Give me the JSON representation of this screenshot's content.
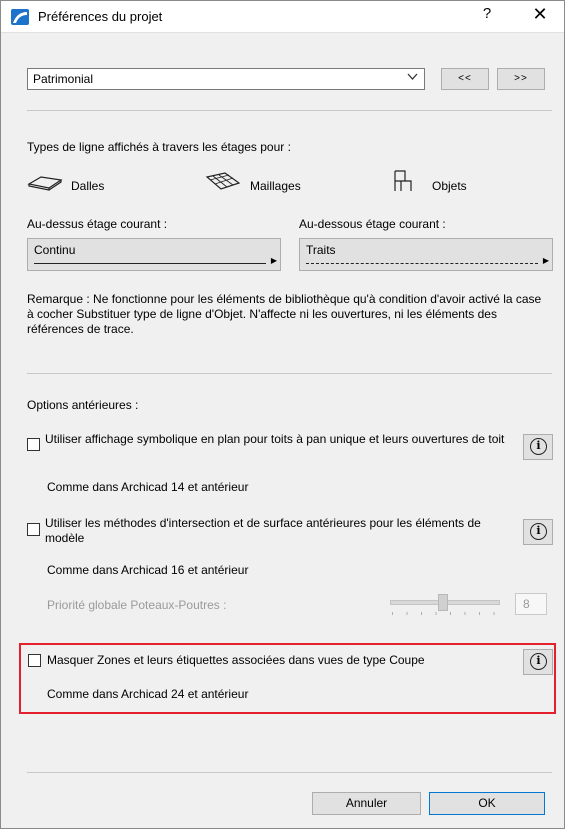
{
  "window": {
    "title": "Préférences du projet",
    "help_label": "?",
    "close_label": "✕"
  },
  "top": {
    "profile_value": "Patrimonial",
    "prev_label": "<<",
    "next_label": ">>"
  },
  "line_types": {
    "heading": "Types de ligne affichés à travers les étages pour :",
    "categories": [
      {
        "label": "Dalles",
        "icon": "slab-icon"
      },
      {
        "label": "Maillages",
        "icon": "mesh-icon"
      },
      {
        "label": "Objets",
        "icon": "chair-icon"
      }
    ],
    "above_label": "Au-dessus étage courant :",
    "below_label": "Au-dessous étage courant :",
    "above_value": "Continu",
    "below_value": "Traits",
    "remark": "Remarque : Ne fonctionne pour les éléments de bibliothèque qu'à condition d'avoir activé la case à cocher Substituer type de ligne d'Objet. N'affecte ni les ouvertures, ni les éléments des références de trace."
  },
  "legacy": {
    "heading": "Options antérieures :",
    "options": [
      {
        "label": "Utiliser affichage symbolique en plan pour toits à pan unique et leurs ouvertures de toit",
        "note": "Comme dans Archicad 14 et antérieur",
        "checked": false
      },
      {
        "label": "Utiliser les méthodes d'intersection et de surface antérieures pour les éléments de modèle",
        "note": "Comme dans Archicad 16 et antérieur",
        "checked": false
      },
      {
        "label": "Masquer Zones et leurs étiquettes associées dans vues de type Coupe",
        "note": "Comme dans Archicad 24 et antérieur",
        "checked": false
      }
    ],
    "priority_label": "Priorité globale Poteaux-Poutres :",
    "priority_value": "8"
  },
  "footer": {
    "cancel_label": "Annuler",
    "ok_label": "OK"
  },
  "colors": {
    "highlight": "#e5202e",
    "accent": "#0078d7"
  }
}
